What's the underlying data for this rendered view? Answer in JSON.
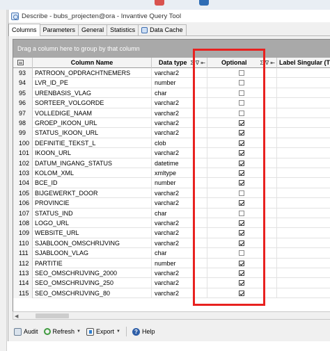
{
  "window": {
    "title": "Describe - bubs_projecten@ora - Invantive Query Tool"
  },
  "tabs": [
    {
      "label": "Columns",
      "active": true
    },
    {
      "label": "Parameters",
      "active": false
    },
    {
      "label": "General",
      "active": false
    },
    {
      "label": "Statistics",
      "active": false
    },
    {
      "label": "Data Cache",
      "active": false,
      "icon": "data-cache-icon"
    }
  ],
  "grid": {
    "group_hint": "Drag a column here to group by that column",
    "headers": {
      "column_name": "Column Name",
      "data_type": "Data type",
      "optional": "Optional",
      "label_singular": "Label Singular (Transla",
      "header_icons": "Σ ∇ ⇤"
    },
    "rows": [
      {
        "num": "93",
        "name": "PATROON_OPDRACHTNEMERS",
        "type": "varchar2",
        "optional": false
      },
      {
        "num": "94",
        "name": "LVR_ID_PE",
        "type": "number",
        "optional": false
      },
      {
        "num": "95",
        "name": "URENBASIS_VLAG",
        "type": "char",
        "optional": false
      },
      {
        "num": "96",
        "name": "SORTEER_VOLGORDE",
        "type": "varchar2",
        "optional": false
      },
      {
        "num": "97",
        "name": "VOLLEDIGE_NAAM",
        "type": "varchar2",
        "optional": false
      },
      {
        "num": "98",
        "name": "GROEP_IKOON_URL",
        "type": "varchar2",
        "optional": true
      },
      {
        "num": "99",
        "name": "STATUS_IKOON_URL",
        "type": "varchar2",
        "optional": true
      },
      {
        "num": "100",
        "name": "DEFINITIE_TEKST_L",
        "type": "clob",
        "optional": true
      },
      {
        "num": "101",
        "name": "IKOON_URL",
        "type": "varchar2",
        "optional": true
      },
      {
        "num": "102",
        "name": "DATUM_INGANG_STATUS",
        "type": "datetime",
        "optional": true
      },
      {
        "num": "103",
        "name": "KOLOM_XML",
        "type": "xmltype",
        "optional": true
      },
      {
        "num": "104",
        "name": "BCE_ID",
        "type": "number",
        "optional": true
      },
      {
        "num": "105",
        "name": "BIJGEWERKT_DOOR",
        "type": "varchar2",
        "optional": false
      },
      {
        "num": "106",
        "name": "PROVINCIE",
        "type": "varchar2",
        "optional": true
      },
      {
        "num": "107",
        "name": "STATUS_IND",
        "type": "char",
        "optional": false
      },
      {
        "num": "108",
        "name": "LOGO_URL",
        "type": "varchar2",
        "optional": true
      },
      {
        "num": "109",
        "name": "WEBSITE_URL",
        "type": "varchar2",
        "optional": true
      },
      {
        "num": "110",
        "name": "SJABLOON_OMSCHRIJVING",
        "type": "varchar2",
        "optional": true
      },
      {
        "num": "111",
        "name": "SJABLOON_VLAG",
        "type": "char",
        "optional": false
      },
      {
        "num": "112",
        "name": "PARTITIE",
        "type": "number",
        "optional": true
      },
      {
        "num": "113",
        "name": "SEO_OMSCHRIJVING_2000",
        "type": "varchar2",
        "optional": true
      },
      {
        "num": "114",
        "name": "SEO_OMSCHRIJVING_250",
        "type": "varchar2",
        "optional": true
      },
      {
        "num": "115",
        "name": "SEO_OMSCHRIJVING_80",
        "type": "varchar2",
        "optional": true
      }
    ]
  },
  "toolbar": {
    "audit_label": "Audit",
    "refresh_label": "Refresh",
    "export_label": "Export",
    "help_label": "Help"
  },
  "colors": {
    "highlight": "#e8211f",
    "group_bar": "#a9a9a9"
  }
}
